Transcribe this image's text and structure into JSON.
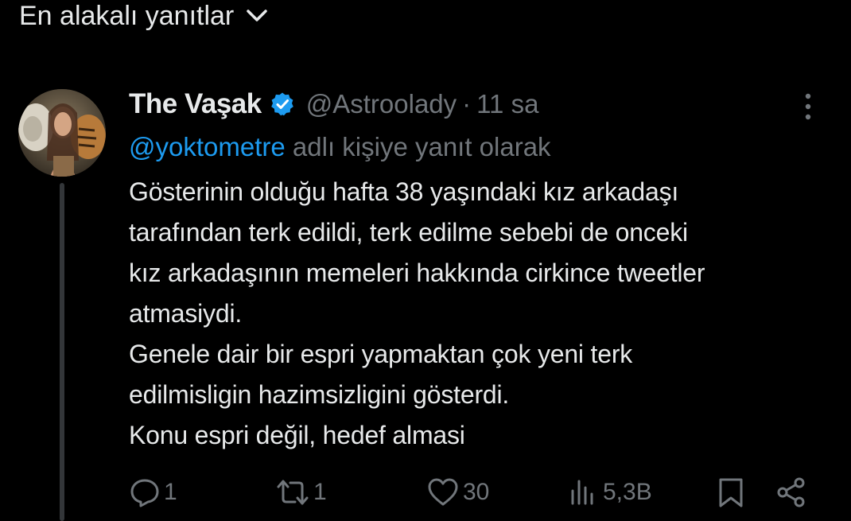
{
  "sort": {
    "label": "En alakalı yanıtlar",
    "icon": "chevron-down-icon"
  },
  "tweet": {
    "author": {
      "display_name": "The Vaşak",
      "verified": true,
      "handle": "@Astroolady"
    },
    "separator": "·",
    "time": "11 sa",
    "reply_to": {
      "mention": "@yoktometre",
      "suffix": " adlı kişiye yanıt olarak"
    },
    "text_lines": [
      "Gösterinin olduğu hafta 38 yaşındaki kız arkadaşı",
      "tarafından terk edildi, terk edilme sebebi de onceki",
      "kız arkadaşının memeleri hakkında cirkince tweetler",
      "atmasiydi.",
      "Genele dair bir espri yapmaktan çok yeni terk",
      "edilmisligin hazimsizligini gösterdi.",
      "Konu espri değil, hedef almasi"
    ],
    "actions": {
      "replies": "1",
      "retweets": "1",
      "likes": "30",
      "views": "5,3B"
    }
  },
  "colors": {
    "background": "#000000",
    "text": "#e7e9ea",
    "secondary": "#71767b",
    "accent": "#1d9bf0",
    "thread_line": "#333639"
  }
}
